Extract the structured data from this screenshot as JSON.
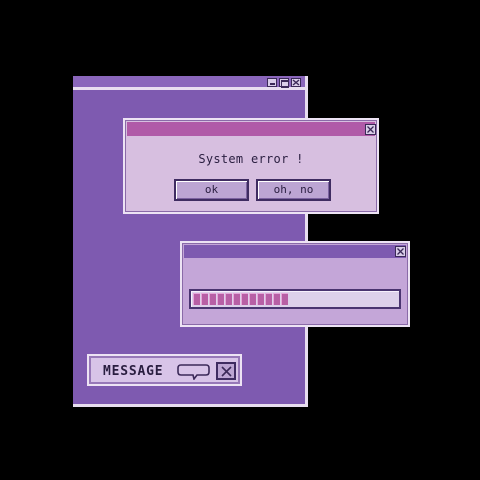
{
  "main_window": {
    "buttons": [
      "minimize-icon",
      "maximize-icon",
      "close-icon"
    ]
  },
  "error_dialog": {
    "message": "System error !",
    "ok_label": "ok",
    "oh_no_label": "oh, no",
    "close_icon": "close-icon"
  },
  "progress_dialog": {
    "progress_fraction": 0.46,
    "close_icon": "close-icon"
  },
  "message_widget": {
    "label": "MESSAGE",
    "icon": "speech-bubble-icon",
    "close_icon": "close-icon"
  },
  "colors": {
    "background": "#000000",
    "window_purple": "#7e5ab0",
    "dialog_lilac": "#d7bfe0",
    "title_magenta": "#b05aa8",
    "progress_pink": "#b85fa5"
  }
}
